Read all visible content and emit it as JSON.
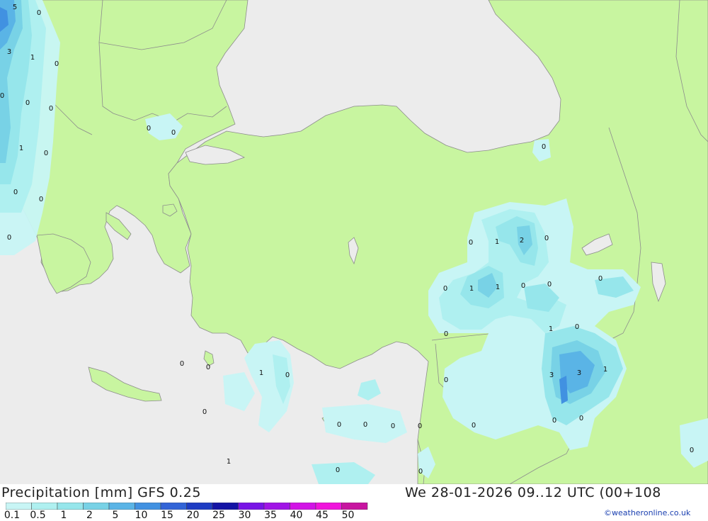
{
  "header": {
    "title": "Precipitation [mm] GFS 0.25",
    "valid_time": "We 28-01-2026 09..12 UTC (00+108",
    "credit": "©weatheronline.co.uk"
  },
  "legend": {
    "labels": [
      "0.1",
      "0.5",
      "1",
      "2",
      "5",
      "10",
      "15",
      "20",
      "25",
      "30",
      "35",
      "40",
      "45",
      "50"
    ],
    "colors": [
      "#c8f5f5",
      "#aff0f0",
      "#96e6eb",
      "#78d2e6",
      "#5ab4e6",
      "#4191e1",
      "#3264d7",
      "#1e3cc3",
      "#1414a5",
      "#7814e6",
      "#a014e6",
      "#d214e6",
      "#f014dc",
      "#c814a0"
    ]
  },
  "map_labels": [
    {
      "text": "5"
    },
    {
      "text": "0"
    },
    {
      "text": "3"
    },
    {
      "text": "1"
    },
    {
      "text": "0"
    },
    {
      "text": "0"
    },
    {
      "text": "0"
    },
    {
      "text": "0"
    },
    {
      "text": "1"
    },
    {
      "text": "0"
    },
    {
      "text": "0"
    },
    {
      "text": "0"
    },
    {
      "text": "0"
    },
    {
      "text": "0"
    },
    {
      "text": "0"
    },
    {
      "text": "0"
    },
    {
      "text": "0"
    },
    {
      "text": "1"
    },
    {
      "text": "2"
    },
    {
      "text": "0"
    },
    {
      "text": "0"
    },
    {
      "text": "1"
    },
    {
      "text": "1"
    },
    {
      "text": "0"
    },
    {
      "text": "0"
    },
    {
      "text": "0"
    },
    {
      "text": "0"
    },
    {
      "text": "1"
    },
    {
      "text": "0"
    },
    {
      "text": "0"
    },
    {
      "text": "3"
    },
    {
      "text": "3"
    },
    {
      "text": "1"
    },
    {
      "text": "0"
    },
    {
      "text": "0"
    },
    {
      "text": "0"
    },
    {
      "text": "0"
    },
    {
      "text": "0"
    },
    {
      "text": "0"
    },
    {
      "text": "1"
    },
    {
      "text": "0"
    },
    {
      "text": "0"
    },
    {
      "text": "0"
    },
    {
      "text": "0"
    },
    {
      "text": "0"
    },
    {
      "text": "0"
    },
    {
      "text": "1"
    },
    {
      "text": "0"
    },
    {
      "text": "0"
    }
  ]
}
